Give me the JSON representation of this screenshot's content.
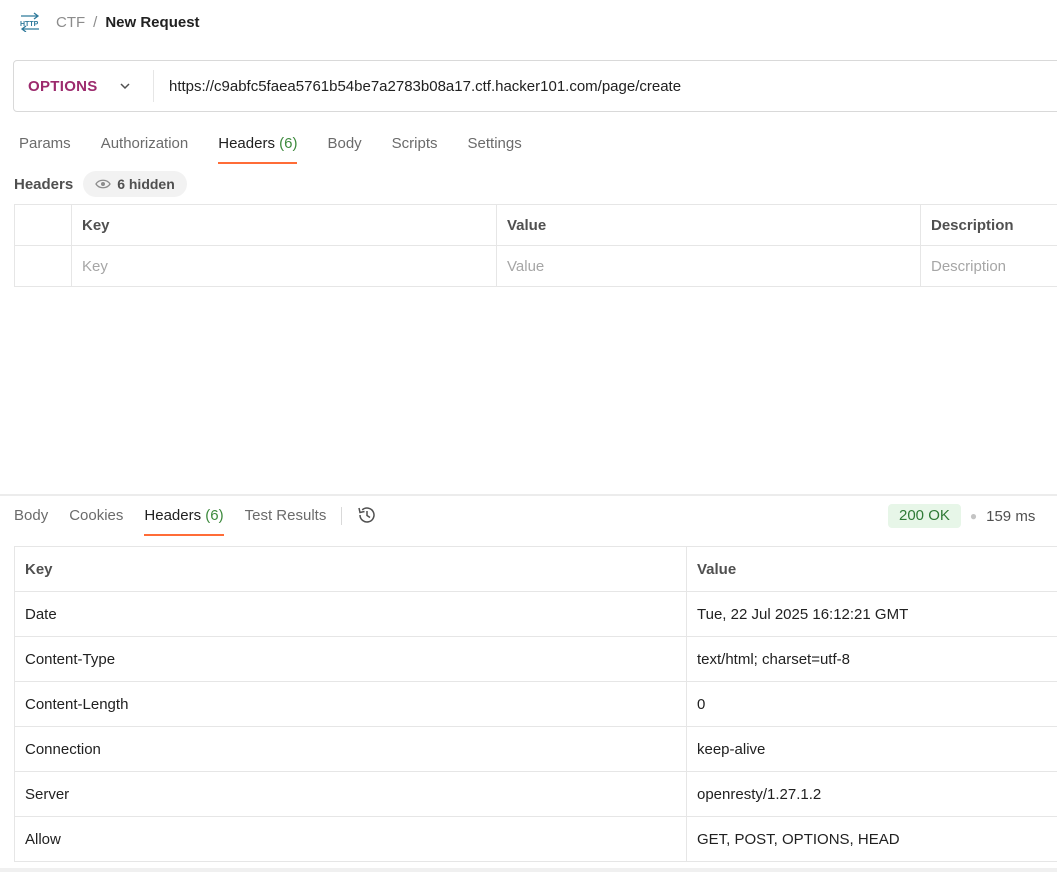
{
  "breadcrumb": {
    "icon": "http-icon",
    "parent": "CTF",
    "separator": "/",
    "current": "New Request"
  },
  "request": {
    "method": "OPTIONS",
    "url": "https://c9abfc5faea5761b54be7a2783b08a17.ctf.hacker101.com/page/create"
  },
  "request_tabs": [
    {
      "label": "Params",
      "count": ""
    },
    {
      "label": "Authorization",
      "count": ""
    },
    {
      "label": "Headers",
      "count": "(6)",
      "active": true
    },
    {
      "label": "Body",
      "count": ""
    },
    {
      "label": "Scripts",
      "count": ""
    },
    {
      "label": "Settings",
      "count": ""
    }
  ],
  "headers_section": {
    "title": "Headers",
    "hidden_label": "6 hidden",
    "columns": {
      "key": "Key",
      "value": "Value",
      "description": "Description"
    },
    "placeholders": {
      "key": "Key",
      "value": "Value",
      "description": "Description"
    }
  },
  "response_tabs": [
    {
      "label": "Body",
      "count": ""
    },
    {
      "label": "Cookies",
      "count": ""
    },
    {
      "label": "Headers",
      "count": "(6)",
      "active": true
    },
    {
      "label": "Test Results",
      "count": ""
    }
  ],
  "response_status": {
    "status": "200 OK",
    "time": "159 ms"
  },
  "response_headers": {
    "columns": {
      "key": "Key",
      "value": "Value"
    },
    "rows": [
      {
        "key": "Date",
        "value": "Tue, 22 Jul 2025 16:12:21 GMT"
      },
      {
        "key": "Content-Type",
        "value": "text/html; charset=utf-8"
      },
      {
        "key": "Content-Length",
        "value": "0"
      },
      {
        "key": "Connection",
        "value": "keep-alive"
      },
      {
        "key": "Server",
        "value": "openresty/1.27.1.2"
      },
      {
        "key": "Allow",
        "value": "GET, POST, OPTIONS, HEAD"
      }
    ]
  },
  "colors": {
    "accent": "#ff6c37",
    "method": "#9c2a6d",
    "status_ok": "#2f7a36"
  }
}
